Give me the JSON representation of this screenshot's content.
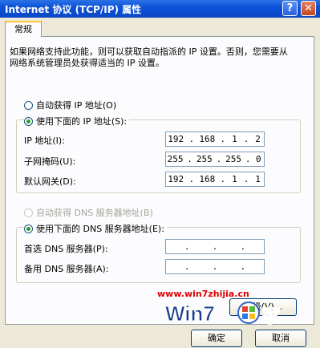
{
  "window": {
    "title": "Internet 协议 (TCP/IP) 属性",
    "help_glyph": "?",
    "close_glyph": "✕"
  },
  "tab": {
    "label": "常规"
  },
  "description": "如果网络支持此功能，则可以获取自动指派的 IP 设置。否则，您需要从网络系统管理员处获得适当的 IP 设置。",
  "ip_section": {
    "auto_label": "自动获得 IP 地址(O)",
    "manual_label": "使用下面的 IP 地址(S):",
    "selected": "manual",
    "ip_label": "IP 地址(I):",
    "mask_label": "子网掩码(U):",
    "gateway_label": "默认网关(D):",
    "ip": [
      "192",
      "168",
      "1",
      "2"
    ],
    "mask": [
      "255",
      "255",
      "255",
      "0"
    ],
    "gateway": [
      "192",
      "168",
      "1",
      "1"
    ]
  },
  "dns_section": {
    "auto_label": "自动获得 DNS 服务器地址(B)",
    "manual_label": "使用下面的 DNS 服务器地址(E):",
    "selected": "manual",
    "preferred_label": "首选 DNS 服务器(P):",
    "alternate_label": "备用 DNS 服务器(A):",
    "dot": "."
  },
  "watermark": {
    "url": "www.win7zhijia.cn",
    "logo_text": "Win7之家"
  },
  "buttons": {
    "advanced": "高级(V)...",
    "ok": "确定",
    "cancel": "取消"
  },
  "colors": {
    "title_blue": "#0a47c6",
    "selected_radio": "#21a121",
    "watermark_red": "#e00000"
  }
}
